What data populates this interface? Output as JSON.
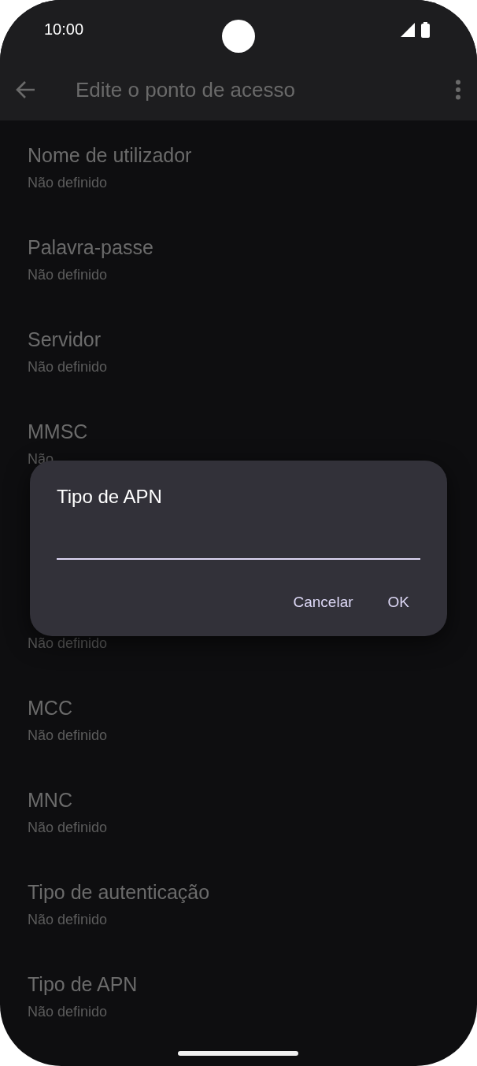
{
  "status_bar": {
    "time": "10:00"
  },
  "app_bar": {
    "title": "Edite o ponto de acesso"
  },
  "settings": [
    {
      "kind": "row",
      "title": "Nome de utilizador",
      "summary": "Não definido"
    },
    {
      "kind": "row",
      "title": "Palavra-passe",
      "summary": "Não definido"
    },
    {
      "kind": "row",
      "title": "Servidor",
      "summary": "Não definido"
    },
    {
      "kind": "row",
      "title": "MMSC",
      "summary": "Não"
    },
    {
      "kind": "covered"
    },
    {
      "kind": "row",
      "summary": "Não definido"
    },
    {
      "kind": "row",
      "title": "MCC",
      "summary": "Não definido"
    },
    {
      "kind": "row",
      "title": "MNC",
      "summary": "Não definido"
    },
    {
      "kind": "row",
      "title": "Tipo de autenticação",
      "summary": "Não definido"
    },
    {
      "kind": "row",
      "title": "Tipo de APN",
      "summary": "Não definido"
    }
  ],
  "dialog": {
    "title": "Tipo de APN",
    "buttons": [
      "Cancelar",
      "OK"
    ]
  }
}
